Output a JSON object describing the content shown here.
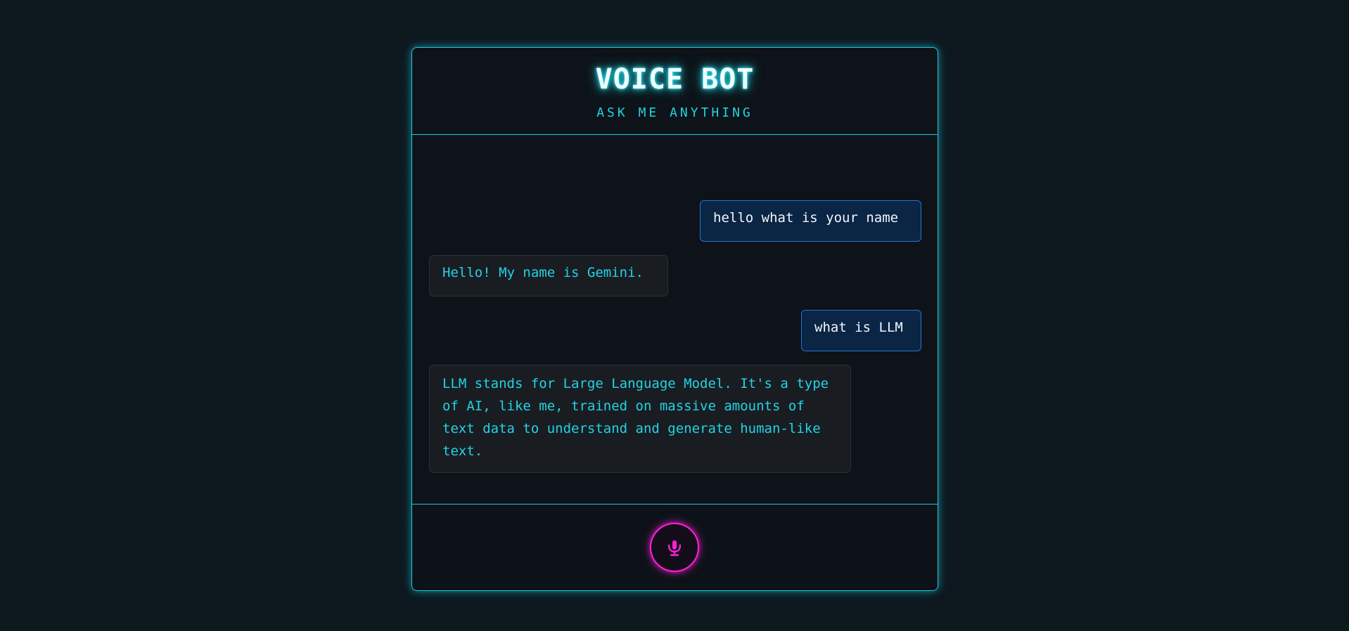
{
  "header": {
    "title": "VOICE BOT",
    "subtitle": "ASK ME ANYTHING"
  },
  "messages": [
    {
      "role": "user",
      "text": "hello what is your name"
    },
    {
      "role": "bot",
      "text": "Hello! My name is Gemini."
    },
    {
      "role": "user",
      "text": "what is LLM"
    },
    {
      "role": "bot",
      "text": "LLM stands for Large Language Model. It's a type of AI, like me, trained on massive amounts of text data to understand and generate human-like text."
    }
  ],
  "controls": {
    "mic_icon": "microphone-icon"
  },
  "colors": {
    "accent_cyan": "#22c7d9",
    "mic_magenta": "#ff1fd9",
    "user_bubble": "#0b2545",
    "bot_bubble": "#191d21",
    "background": "#0c161d"
  }
}
